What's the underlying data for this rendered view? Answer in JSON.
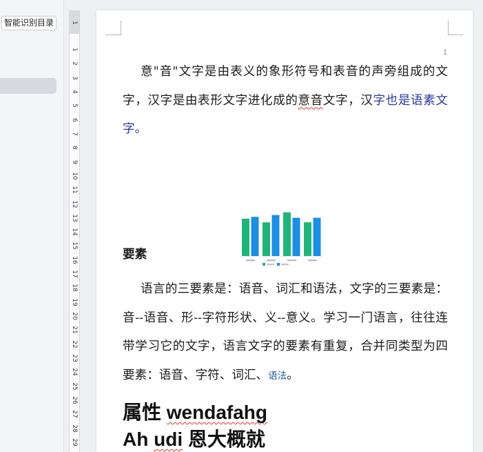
{
  "nav_panel": {
    "smart_toc_button": "智能识别目录"
  },
  "ruler": {
    "top_label": "1",
    "numbers": [
      "1",
      "2",
      "3",
      "4",
      "5",
      "6",
      "7",
      "8",
      "9",
      "10",
      "11",
      "12",
      "13",
      "14",
      "15",
      "16",
      "17",
      "18",
      "19",
      "20",
      "21",
      "22",
      "23",
      "24",
      "25",
      "26",
      "27",
      "28",
      "29"
    ]
  },
  "document": {
    "page_number": "1",
    "paragraph_1": {
      "line_1": "意\"音\"文字是由表义的象形符号和表音的声旁组成的文",
      "line_2": [
        "字，汉字是由表形文字进化成的",
        "意音",
        "文字，汉",
        "字也是语素文"
      ],
      "line_3": "字。"
    },
    "section_heading": "要素",
    "paragraph_2": {
      "line_1": "语言的三要素是：语音、词汇和语法，文字的三要素是：",
      "line_2": "音--语音、形--字符形状、义--意义。学习一门语言，往往连",
      "line_3": "带学习它的文字，语言文字的要素有重复，合并同类型为四",
      "line_4": [
        "要素：语音、字符、词汇、",
        "语法",
        "。"
      ]
    },
    "heading_1": [
      "属性 ",
      "wendafahg"
    ],
    "heading_2": [
      "Ah ",
      "udi",
      " 恩大概就"
    ]
  },
  "colors": {
    "text": "#1b1b1b",
    "blue_text": "#2b3a9c",
    "field_text": "#1d5aa8",
    "spell_error_underline": "#e03030",
    "nav_selected": "#d6d9de"
  },
  "chart_data": {
    "type": "bar",
    "series": [
      {
        "color": "#1fb57a",
        "values": [
          4.1,
          3.7,
          4.8,
          3.7
        ]
      },
      {
        "color": "#1a8fe3",
        "values": [
          4.3,
          4.5,
          4.2,
          4.2
        ]
      }
    ],
    "ylim": [
      0,
      5
    ],
    "grid": false,
    "legend": "bottom"
  }
}
